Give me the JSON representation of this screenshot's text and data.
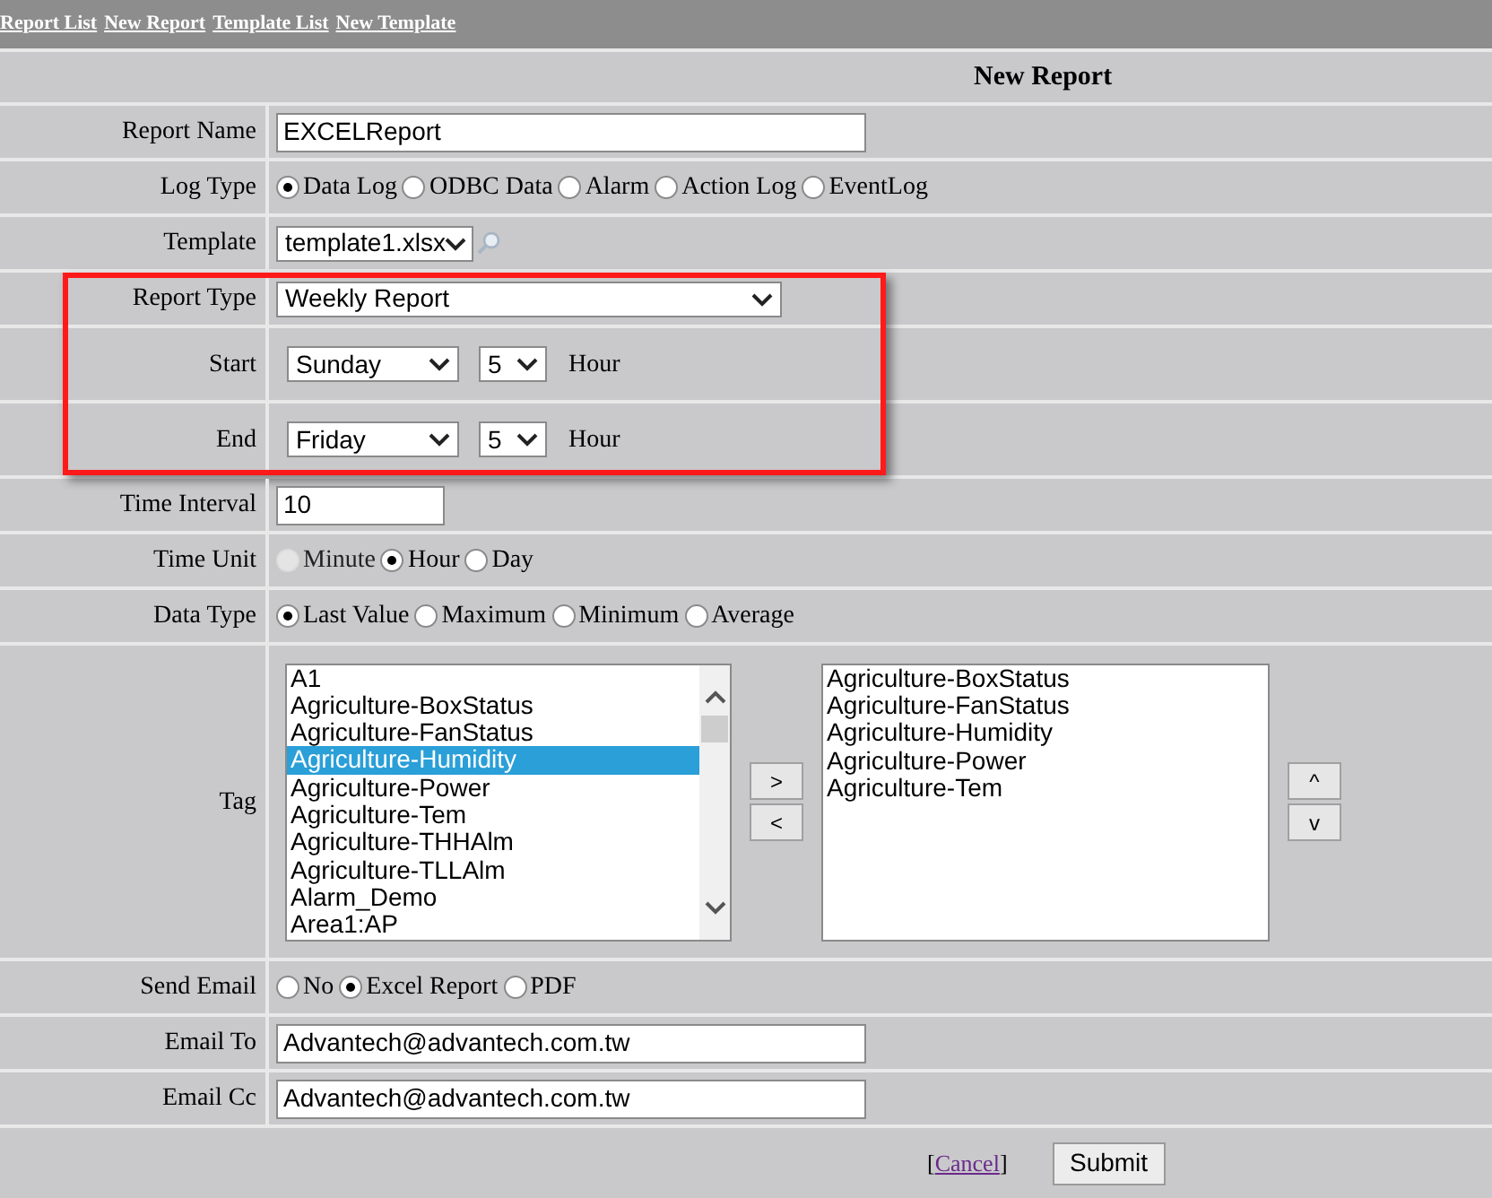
{
  "nav": [
    {
      "label": "Report List"
    },
    {
      "label": "New Report"
    },
    {
      "label": "Template List"
    },
    {
      "label": "New Template"
    }
  ],
  "title": "New Report",
  "rows": [
    {
      "kind": "text",
      "label": "Report Name",
      "value": "EXCELReport",
      "highlighted": false
    },
    {
      "kind": "radio",
      "label": "Log Type",
      "highlighted": false,
      "options": [
        {
          "label": "Data Log",
          "selected": true,
          "disabled": false
        },
        {
          "label": "ODBC Data",
          "selected": false,
          "disabled": false
        },
        {
          "label": "Alarm",
          "selected": false,
          "disabled": false
        },
        {
          "label": "Action Log",
          "selected": false,
          "disabled": false
        },
        {
          "label": "EventLog",
          "selected": false,
          "disabled": false
        }
      ]
    },
    {
      "kind": "template",
      "label": "Template",
      "value": "template1.xlsx",
      "highlighted": false
    },
    {
      "kind": "select",
      "label": "Report Type",
      "value": "Weekly Report",
      "highlighted": true
    },
    {
      "kind": "day_hour",
      "label": "Start",
      "day": "Sunday",
      "hour": "5",
      "unit": "Hour",
      "highlighted": true
    },
    {
      "kind": "day_hour",
      "label": "End",
      "day": "Friday",
      "hour": "5",
      "unit": "Hour",
      "highlighted": true
    },
    {
      "kind": "short_text",
      "label": "Time Interval",
      "value": "10",
      "highlighted": false
    },
    {
      "kind": "radio",
      "label": "Time Unit",
      "highlighted": false,
      "options": [
        {
          "label": "Minute",
          "selected": false,
          "disabled": true
        },
        {
          "label": "Hour",
          "selected": true,
          "disabled": false
        },
        {
          "label": "Day",
          "selected": false,
          "disabled": false
        }
      ]
    },
    {
      "kind": "radio",
      "label": "Data Type",
      "highlighted": false,
      "options": [
        {
          "label": "Last Value",
          "selected": true,
          "disabled": false
        },
        {
          "label": "Maximum",
          "selected": false,
          "disabled": false
        },
        {
          "label": "Minimum",
          "selected": false,
          "disabled": false
        },
        {
          "label": "Average",
          "selected": false,
          "disabled": false
        }
      ]
    },
    {
      "kind": "tags",
      "label": "Tag",
      "highlighted": false,
      "add_button": ">",
      "remove_button": "<",
      "up_button": "^",
      "down_button": "v",
      "available": [
        {
          "label": "A1",
          "selected": false
        },
        {
          "label": "Agriculture-BoxStatus",
          "selected": false
        },
        {
          "label": "Agriculture-FanStatus",
          "selected": false
        },
        {
          "label": "Agriculture-Humidity",
          "selected": true
        },
        {
          "label": "Agriculture-Power",
          "selected": false
        },
        {
          "label": "Agriculture-Tem",
          "selected": false
        },
        {
          "label": "Agriculture-THHAlm",
          "selected": false
        },
        {
          "label": "Agriculture-TLLAlm",
          "selected": false
        },
        {
          "label": "Alarm_Demo",
          "selected": false
        },
        {
          "label": "Area1:AP",
          "selected": false
        }
      ],
      "chosen": [
        {
          "label": "Agriculture-BoxStatus",
          "selected": false
        },
        {
          "label": "Agriculture-FanStatus",
          "selected": false
        },
        {
          "label": "Agriculture-Humidity",
          "selected": false
        },
        {
          "label": "Agriculture-Power",
          "selected": false
        },
        {
          "label": "Agriculture-Tem",
          "selected": false
        }
      ]
    },
    {
      "kind": "radio",
      "label": "Send Email",
      "highlighted": false,
      "options": [
        {
          "label": "No",
          "selected": false,
          "disabled": false
        },
        {
          "label": "Excel Report",
          "selected": true,
          "disabled": false
        },
        {
          "label": "PDF",
          "selected": false,
          "disabled": false
        }
      ]
    },
    {
      "kind": "text",
      "label": "Email To",
      "value": "Advantech@advantech.com.tw",
      "highlighted": false
    },
    {
      "kind": "text",
      "label": "Email Cc",
      "value": "Advantech@advantech.com.tw",
      "highlighted": false
    }
  ],
  "cancel": {
    "open": "[",
    "label": "Cancel",
    "close": "]"
  },
  "submit": "Submit"
}
